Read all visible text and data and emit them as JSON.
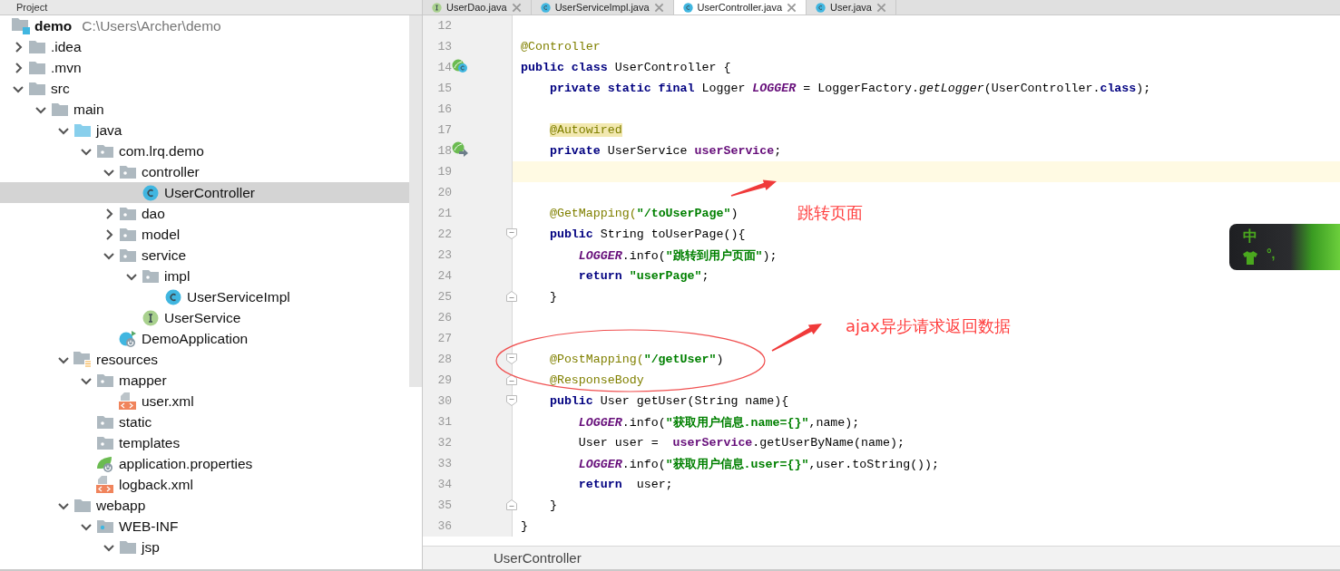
{
  "project_panel": {
    "title": "Project",
    "tree": [
      {
        "name": "demo",
        "path": "C:\\Users\\Archer\\demo",
        "kind": "module",
        "selected": false,
        "children": [
          {
            "name": ".idea",
            "kind": "folder",
            "expanded": false,
            "selected": false
          },
          {
            "name": ".mvn",
            "kind": "folder",
            "expanded": false,
            "selected": false
          },
          {
            "name": "src",
            "kind": "folder",
            "expanded": true,
            "selected": false,
            "children": [
              {
                "name": "main",
                "kind": "folder",
                "expanded": true,
                "selected": false,
                "children": [
                  {
                    "name": "java",
                    "kind": "source-folder",
                    "expanded": true,
                    "selected": false,
                    "children": [
                      {
                        "name": "com.lrq.demo",
                        "kind": "package",
                        "expanded": true,
                        "selected": false,
                        "children": [
                          {
                            "name": "controller",
                            "kind": "package",
                            "expanded": true,
                            "selected": false,
                            "children": [
                              {
                                "name": "UserController",
                                "kind": "class",
                                "selected": true
                              }
                            ]
                          },
                          {
                            "name": "dao",
                            "kind": "package",
                            "expanded": false,
                            "selected": false
                          },
                          {
                            "name": "model",
                            "kind": "package",
                            "expanded": false,
                            "selected": false
                          },
                          {
                            "name": "service",
                            "kind": "package",
                            "expanded": true,
                            "selected": false,
                            "children": [
                              {
                                "name": "impl",
                                "kind": "package",
                                "expanded": true,
                                "selected": false,
                                "children": [
                                  {
                                    "name": "UserServiceImpl",
                                    "kind": "class",
                                    "selected": false
                                  }
                                ]
                              },
                              {
                                "name": "UserService",
                                "kind": "interface",
                                "selected": false
                              }
                            ]
                          },
                          {
                            "name": "DemoApplication",
                            "kind": "boot-app",
                            "selected": false
                          }
                        ]
                      }
                    ]
                  },
                  {
                    "name": "resources",
                    "kind": "resources-folder",
                    "expanded": true,
                    "selected": false,
                    "children": [
                      {
                        "name": "mapper",
                        "kind": "package",
                        "expanded": true,
                        "selected": false,
                        "children": [
                          {
                            "name": "user.xml",
                            "kind": "xml",
                            "selected": false
                          }
                        ]
                      },
                      {
                        "name": "static",
                        "kind": "package",
                        "selected": false
                      },
                      {
                        "name": "templates",
                        "kind": "package",
                        "selected": false
                      },
                      {
                        "name": "application.properties",
                        "kind": "properties",
                        "selected": false
                      },
                      {
                        "name": "logback.xml",
                        "kind": "xml",
                        "selected": false
                      }
                    ]
                  },
                  {
                    "name": "webapp",
                    "kind": "folder",
                    "expanded": true,
                    "selected": false,
                    "children": [
                      {
                        "name": "WEB-INF",
                        "kind": "web-inf",
                        "expanded": true,
                        "selected": false,
                        "children": [
                          {
                            "name": "jsp",
                            "kind": "folder",
                            "expanded": true,
                            "selected": false
                          }
                        ]
                      }
                    ]
                  }
                ]
              }
            ]
          }
        ]
      }
    ]
  },
  "editor": {
    "tabs": [
      {
        "label": "UserDao.java",
        "kind": "interface",
        "selected": false
      },
      {
        "label": "UserServiceImpl.java",
        "kind": "class",
        "selected": false
      },
      {
        "label": "UserController.java",
        "kind": "class",
        "selected": true
      },
      {
        "label": "User.java",
        "kind": "class",
        "selected": false
      }
    ],
    "lines": [
      {
        "number": "12",
        "kind": "plain",
        "current": false
      },
      {
        "number": "13",
        "kind": "plain",
        "current": false,
        "tokens": [
          {
            "kind": "ann",
            "text": "@Controller"
          }
        ]
      },
      {
        "number": "14",
        "kind": "bean",
        "current": false,
        "tokens": [
          {
            "kind": "kw",
            "text": "public class "
          },
          {
            "kind": "plain",
            "text": "UserController {"
          }
        ]
      },
      {
        "number": "15",
        "kind": "plain",
        "current": false,
        "tokens": [
          {
            "kind": "kw",
            "text": "    private static final "
          },
          {
            "kind": "plain",
            "text": "Logger "
          },
          {
            "kind": "static",
            "text": "LOGGER"
          },
          {
            "kind": "plain",
            "text": " = LoggerFactory."
          },
          {
            "kind": "method",
            "text": "getLogger"
          },
          {
            "kind": "plain",
            "text": "(UserController."
          },
          {
            "kind": "kw",
            "text": "class"
          },
          {
            "kind": "plain",
            "text": ");"
          }
        ]
      },
      {
        "number": "16",
        "kind": "plain",
        "current": false
      },
      {
        "number": "17",
        "kind": "plain",
        "current": false,
        "tokens": [
          {
            "kind": "ann-hl",
            "text": "    @Autowired"
          }
        ]
      },
      {
        "number": "18",
        "kind": "autowired",
        "current": false,
        "tokens": [
          {
            "kind": "kw",
            "text": "    private "
          },
          {
            "kind": "plain",
            "text": "UserService "
          },
          {
            "kind": "field",
            "text": "userService"
          },
          {
            "kind": "plain",
            "text": ";"
          }
        ]
      },
      {
        "number": "19",
        "kind": "plain",
        "current": true
      },
      {
        "number": "20",
        "kind": "plain",
        "current": false
      },
      {
        "number": "21",
        "kind": "plain",
        "current": false,
        "tokens": [
          {
            "kind": "ann",
            "text": "    @GetMapping("
          },
          {
            "kind": "str",
            "text": "\"/toUserPage\""
          },
          {
            "kind": "plain",
            "text": ")"
          }
        ]
      },
      {
        "number": "22",
        "kind": "fold-start",
        "current": false,
        "tokens": [
          {
            "kind": "kw",
            "text": "    public "
          },
          {
            "kind": "plain",
            "text": "String toUserPage(){"
          }
        ]
      },
      {
        "number": "23",
        "kind": "plain",
        "current": false,
        "tokens": [
          {
            "kind": "static",
            "text": "        LOGGER"
          },
          {
            "kind": "plain",
            "text": ".info("
          },
          {
            "kind": "str",
            "text": "\"跳转到用户页面\""
          },
          {
            "kind": "plain",
            "text": ");"
          }
        ]
      },
      {
        "number": "24",
        "kind": "plain",
        "current": false,
        "tokens": [
          {
            "kind": "kw",
            "text": "        return "
          },
          {
            "kind": "str",
            "text": "\"userPage\""
          },
          {
            "kind": "plain",
            "text": ";"
          }
        ]
      },
      {
        "number": "25",
        "kind": "fold-end",
        "current": false,
        "tokens": [
          {
            "kind": "plain",
            "text": "    }"
          }
        ]
      },
      {
        "number": "26",
        "kind": "plain",
        "current": false
      },
      {
        "number": "27",
        "kind": "plain",
        "current": false
      },
      {
        "number": "28",
        "kind": "fold-start",
        "current": false,
        "tokens": [
          {
            "kind": "ann",
            "text": "    @PostMapping("
          },
          {
            "kind": "str",
            "text": "\"/getUser\""
          },
          {
            "kind": "plain",
            "text": ")"
          }
        ]
      },
      {
        "number": "29",
        "kind": "fold-end",
        "current": false,
        "tokens": [
          {
            "kind": "ann",
            "text": "    @ResponseBody"
          }
        ]
      },
      {
        "number": "30",
        "kind": "fold-start",
        "current": false,
        "tokens": [
          {
            "kind": "kw",
            "text": "    public "
          },
          {
            "kind": "plain",
            "text": "User getUser(String name){"
          }
        ]
      },
      {
        "number": "31",
        "kind": "plain",
        "current": false,
        "tokens": [
          {
            "kind": "static",
            "text": "        LOGGER"
          },
          {
            "kind": "plain",
            "text": ".info("
          },
          {
            "kind": "str",
            "text": "\"获取用户信息.name={}\""
          },
          {
            "kind": "plain",
            "text": ",name);"
          }
        ]
      },
      {
        "number": "32",
        "kind": "plain",
        "current": false,
        "tokens": [
          {
            "kind": "plain",
            "text": "        User user =  "
          },
          {
            "kind": "field",
            "text": "userService"
          },
          {
            "kind": "plain",
            "text": ".getUserByName(name);"
          }
        ]
      },
      {
        "number": "33",
        "kind": "plain",
        "current": false,
        "tokens": [
          {
            "kind": "static",
            "text": "        LOGGER"
          },
          {
            "kind": "plain",
            "text": ".info("
          },
          {
            "kind": "str",
            "text": "\"获取用户信息.user={}\""
          },
          {
            "kind": "plain",
            "text": ",user.toString());"
          }
        ]
      },
      {
        "number": "34",
        "kind": "plain",
        "current": false,
        "tokens": [
          {
            "kind": "kw",
            "text": "        return "
          },
          {
            "kind": "plain",
            "text": " user;"
          }
        ]
      },
      {
        "number": "35",
        "kind": "fold-end",
        "current": false,
        "tokens": [
          {
            "kind": "plain",
            "text": "    }"
          }
        ]
      },
      {
        "number": "36",
        "kind": "plain",
        "current": false,
        "tokens": [
          {
            "kind": "plain",
            "text": "}"
          }
        ]
      }
    ],
    "breadcrumb": "UserController"
  },
  "annotations": [
    {
      "kind": "arrow-note",
      "text": "跳转页面"
    },
    {
      "kind": "ellipse"
    },
    {
      "kind": "arrow-note",
      "text": "ajax异步请求返回数据"
    }
  ],
  "ime_toolbar": {
    "mode": "中",
    "punctuation": "°,"
  }
}
